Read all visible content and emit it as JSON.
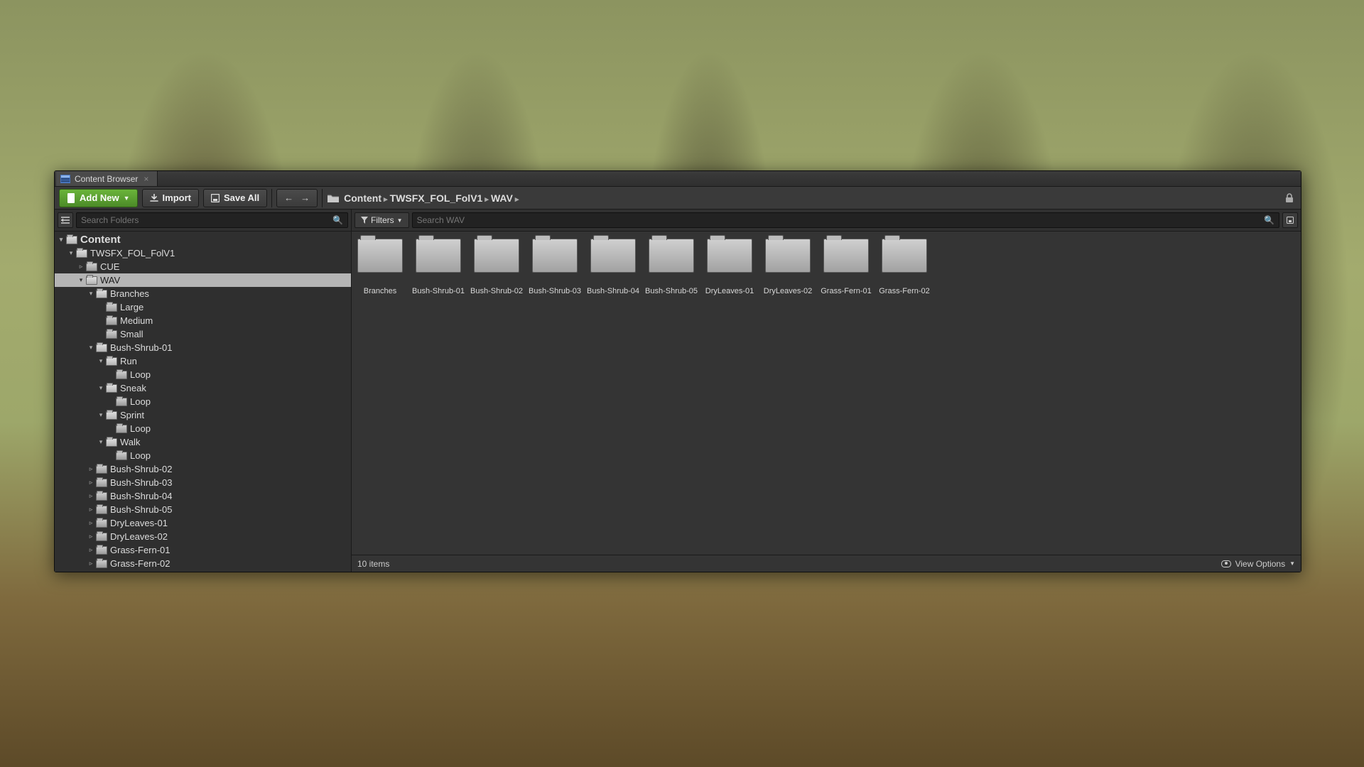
{
  "tab_title": "Content Browser",
  "toolbar": {
    "add_new": "Add New",
    "import": "Import",
    "save_all": "Save All"
  },
  "breadcrumbs": [
    "Content",
    "TWSFX_FOL_FolV1",
    "WAV"
  ],
  "left": {
    "search_placeholder": "Search Folders",
    "tree": [
      {
        "d": 0,
        "tw": "▾",
        "label": "Content",
        "root": true,
        "open": true
      },
      {
        "d": 1,
        "tw": "▾",
        "label": "TWSFX_FOL_FolV1",
        "open": true
      },
      {
        "d": 2,
        "tw": "▹",
        "label": "CUE"
      },
      {
        "d": 2,
        "tw": "▾",
        "label": "WAV",
        "open": true,
        "selected": true
      },
      {
        "d": 3,
        "tw": "▾",
        "label": "Branches",
        "open": true
      },
      {
        "d": 4,
        "tw": "",
        "label": "Large"
      },
      {
        "d": 4,
        "tw": "",
        "label": "Medium"
      },
      {
        "d": 4,
        "tw": "",
        "label": "Small"
      },
      {
        "d": 3,
        "tw": "▾",
        "label": "Bush-Shrub-01",
        "open": true
      },
      {
        "d": 4,
        "tw": "▾",
        "label": "Run",
        "open": true
      },
      {
        "d": 5,
        "tw": "",
        "label": "Loop"
      },
      {
        "d": 4,
        "tw": "▾",
        "label": "Sneak",
        "open": true
      },
      {
        "d": 5,
        "tw": "",
        "label": "Loop"
      },
      {
        "d": 4,
        "tw": "▾",
        "label": "Sprint",
        "open": true
      },
      {
        "d": 5,
        "tw": "",
        "label": "Loop"
      },
      {
        "d": 4,
        "tw": "▾",
        "label": "Walk",
        "open": true
      },
      {
        "d": 5,
        "tw": "",
        "label": "Loop"
      },
      {
        "d": 3,
        "tw": "▹",
        "label": "Bush-Shrub-02"
      },
      {
        "d": 3,
        "tw": "▹",
        "label": "Bush-Shrub-03"
      },
      {
        "d": 3,
        "tw": "▹",
        "label": "Bush-Shrub-04"
      },
      {
        "d": 3,
        "tw": "▹",
        "label": "Bush-Shrub-05"
      },
      {
        "d": 3,
        "tw": "▹",
        "label": "DryLeaves-01"
      },
      {
        "d": 3,
        "tw": "▹",
        "label": "DryLeaves-02"
      },
      {
        "d": 3,
        "tw": "▹",
        "label": "Grass-Fern-01"
      },
      {
        "d": 3,
        "tw": "▹",
        "label": "Grass-Fern-02"
      }
    ]
  },
  "right": {
    "filters_label": "Filters",
    "search_placeholder": "Search WAV",
    "items": [
      "Branches",
      "Bush-Shrub-01",
      "Bush-Shrub-02",
      "Bush-Shrub-03",
      "Bush-Shrub-04",
      "Bush-Shrub-05",
      "DryLeaves-01",
      "DryLeaves-02",
      "Grass-Fern-01",
      "Grass-Fern-02"
    ],
    "status_count": "10 items",
    "view_options": "View Options"
  }
}
